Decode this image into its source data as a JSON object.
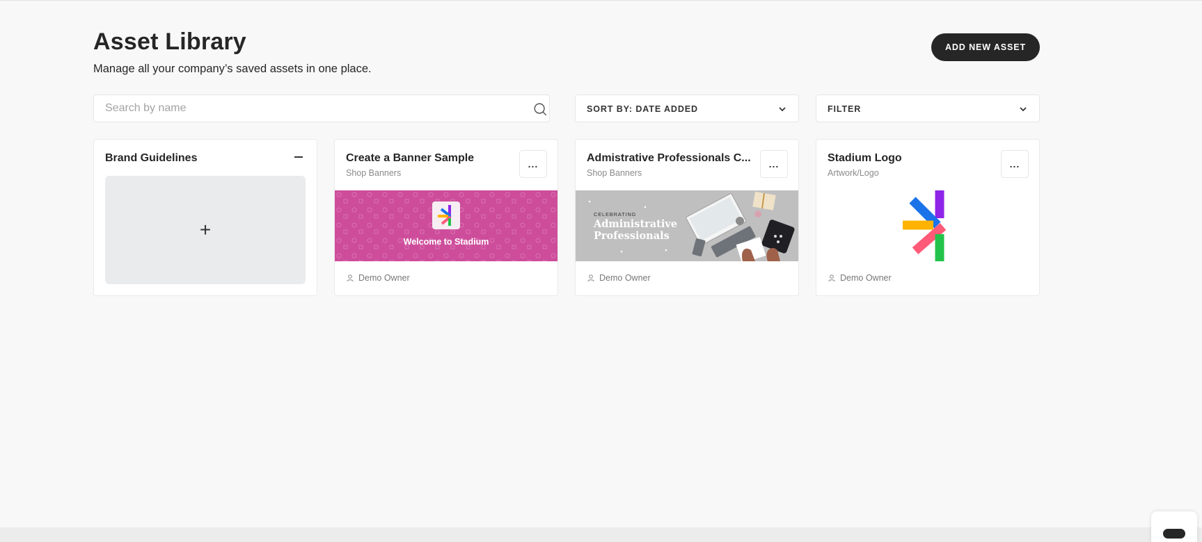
{
  "header": {
    "title": "Asset Library",
    "subtitle": "Manage all your company’s saved assets in one place.",
    "add_button": "ADD NEW ASSET"
  },
  "toolbar": {
    "search_placeholder": "Search by name",
    "search_value": "",
    "sort_label": "SORT BY: DATE ADDED",
    "filter_label": "FILTER"
  },
  "brand_card": {
    "title": "Brand Guidelines",
    "add_glyph": "+"
  },
  "assets": [
    {
      "title": "Create a Banner Sample",
      "category": "Shop Banners",
      "owner": "Demo Owner",
      "more": "...",
      "thumb_text": "Welcome to Stadium",
      "thumb_color": "#cd4d9b"
    },
    {
      "title": "Admistrative Professionals C...",
      "category": "Shop Banners",
      "owner": "Demo Owner",
      "more": "...",
      "thumb_small": "CELEBRATING",
      "thumb_line1": "Administrative",
      "thumb_line2": "Professionals",
      "thumb_color": "#bdbdbd"
    },
    {
      "title": "Stadium Logo",
      "category": "Artwork/Logo",
      "owner": "Demo Owner",
      "more": "...",
      "thumb_color": "#ffffff"
    }
  ],
  "colors": {
    "accent": "#262626",
    "background": "#f8f8f8",
    "logo_blue": "#1a73e8",
    "logo_purple": "#8e24e8",
    "logo_orange": "#ffb300",
    "logo_pink": "#ff5a78",
    "logo_green": "#22c34a"
  }
}
